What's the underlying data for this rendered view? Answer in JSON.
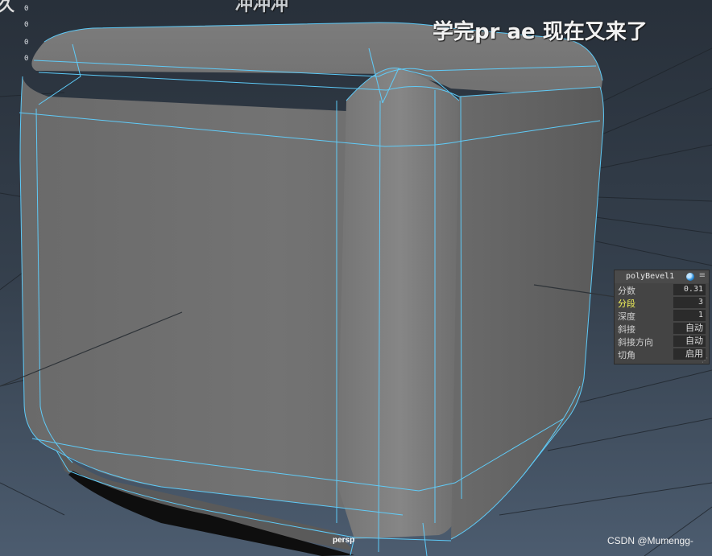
{
  "viewport": {
    "camera_label": "persp",
    "hud_counters": [
      "0",
      "0",
      "0",
      "0"
    ]
  },
  "overlay": {
    "caption_top": "冲冲冲",
    "caption_main": "学完pr ae 现在又来了",
    "watermark": "CSDN @Mumengg-",
    "left_glyph": "久"
  },
  "inputs_panel": {
    "title": "polyBevel1",
    "toggle_icon": "node-state-icon",
    "menu_icon": "panel-menu-icon",
    "rows": [
      {
        "label": "分数",
        "value": "0.31",
        "active": false
      },
      {
        "label": "分段",
        "value": "3",
        "active": true
      },
      {
        "label": "深度",
        "value": "1",
        "active": false
      },
      {
        "label": "斜接",
        "value": "自动",
        "active": false
      },
      {
        "label": "斜接方向",
        "value": "自动",
        "active": false
      },
      {
        "label": "切角",
        "value": "启用",
        "active": false
      }
    ]
  },
  "colors": {
    "background_top": "#2c333c",
    "background_bottom": "#4a5a6c",
    "cube_face": "#6f6f6f",
    "wireframe": "#5fd0ff",
    "active_attr": "#f3f35a"
  }
}
